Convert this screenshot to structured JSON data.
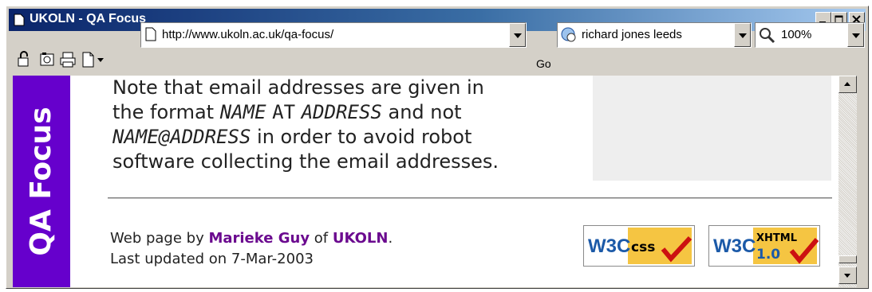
{
  "window": {
    "title": "UKOLN - QA Focus"
  },
  "toolbar": {
    "address": "http://www.ukoln.ac.uk/qa-focus/",
    "go_label": "Go",
    "search_value": "richard jones leeds",
    "zoom_value": "100%"
  },
  "page": {
    "sidebar_title": "QA Focus",
    "note": {
      "line1": "Note that email addresses are given in",
      "line2_a": "the format ",
      "line2_name": "NAME",
      "line2_at": "AT",
      "line2_address": "ADDRESS",
      "line2_b": " and not",
      "line3_code": "NAME@ADDRESS",
      "line3_b": " in order to avoid robot",
      "line4": "software collecting the email addresses."
    },
    "footer": {
      "prefix": "Web page by ",
      "author": "Marieke Guy",
      "middle": " of ",
      "org": "UKOLN",
      "suffix": ".",
      "updated": "Last updated on 7-Mar-2003"
    },
    "badges": {
      "css": "W3C css",
      "xhtml": "W3C XHTML 1.0"
    }
  },
  "colors": {
    "sidebar": "#6600cc",
    "link": "#6b0a8f",
    "titlebar_start": "#0a246a"
  }
}
